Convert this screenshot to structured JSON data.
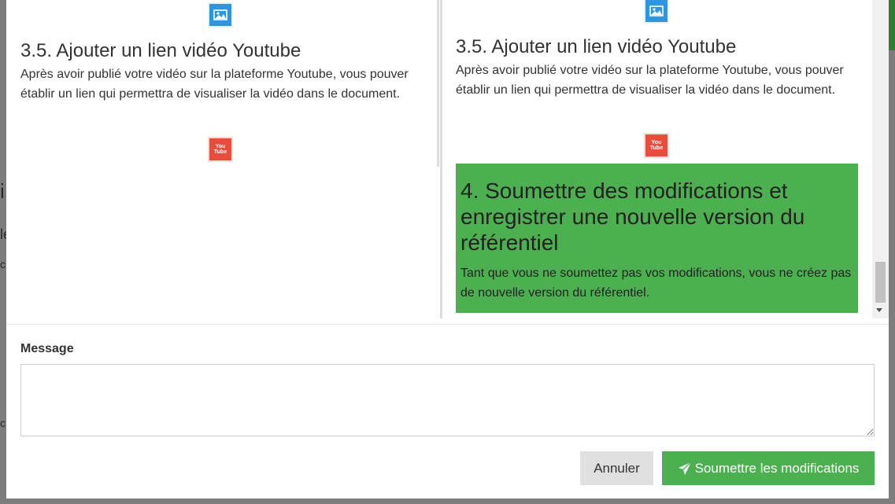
{
  "left": {
    "section_title": "3.5. Ajouter un lien vidéo Youtube",
    "section_text": "Après avoir publié votre vidéo sur la plateforme Youtube, vous pouver établir un lien qui permettra de visualiser la vidéo dans le document."
  },
  "right": {
    "section_title": "3.5. Ajouter un lien vidéo Youtube",
    "section_text": "Après avoir publié votre vidéo sur la plateforme Youtube, vous pouver établir un lien qui permettra de visualiser la vidéo dans le document.",
    "added_title": "4. Soumettre des modifications et enregistrer une nouvelle version du référentiel",
    "added_text": "Tant que vous ne soumettez pas vos modifications, vous ne créez pas de nouvelle version du référentiel."
  },
  "youtube_icon_text": "You Tube",
  "icons": {
    "image": "image-icon",
    "youtube": "youtube-icon",
    "send": "paper-plane-icon"
  },
  "colors": {
    "added_highlight": "#4caf50",
    "image_icon": "#2e96e0",
    "youtube_icon": "#e84c3d",
    "submit_button": "#4caf50"
  },
  "form": {
    "message_label": "Message",
    "message_value": "",
    "message_placeholder": ""
  },
  "buttons": {
    "cancel": "Annuler",
    "submit": "Soumettre les modifications"
  }
}
